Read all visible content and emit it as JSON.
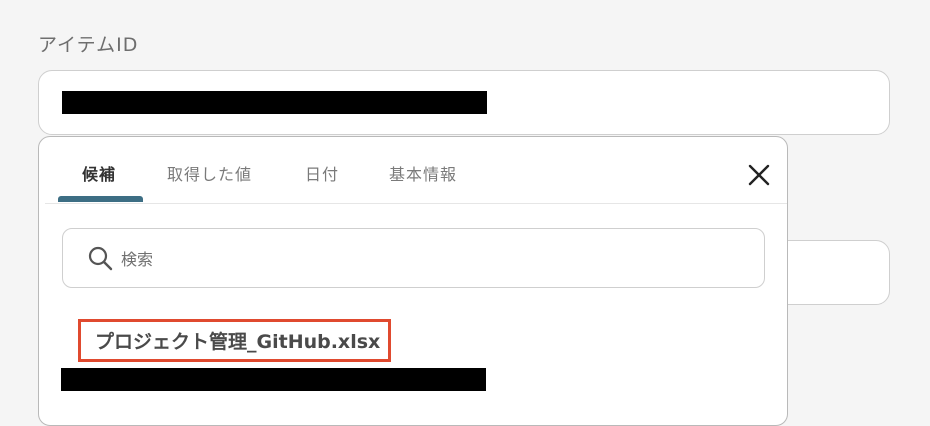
{
  "field": {
    "label": "アイテムID"
  },
  "popover": {
    "tabs": [
      {
        "label": "候補",
        "active": true
      },
      {
        "label": "取得した値",
        "active": false
      },
      {
        "label": "日付",
        "active": false
      },
      {
        "label": "基本情報",
        "active": false
      }
    ],
    "close_icon": "close-icon",
    "search": {
      "placeholder": "検索",
      "value": "",
      "icon": "search-icon"
    },
    "candidates": [
      {
        "label": "プロジェクト管理_GitHub.xlsx"
      }
    ]
  },
  "colors": {
    "accent": "#3d6e84",
    "highlight": "#e04a2f"
  }
}
